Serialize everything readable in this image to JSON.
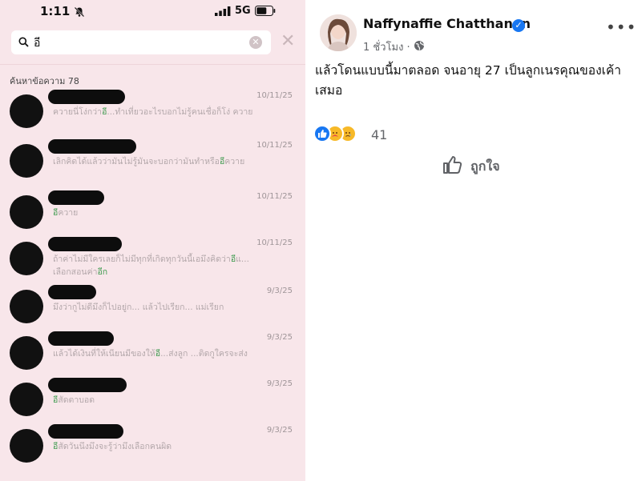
{
  "phone": {
    "status_time": "1:11",
    "network": "5G",
    "search_query": "อี",
    "result_count_label": "ค้นหาข้อความ 78",
    "results": [
      {
        "date": "10/11/25",
        "pre": "ควายนี่โง่กว่า",
        "hl": "อี",
        "post": "...ทำเที่ยวอะไรบอกไม่รู้คนเชื่อก็โง่ ควาย"
      },
      {
        "date": "10/11/25",
        "pre": "เลิกคิดได้แล้วว่ามันไม่รู้มันจะบอกว่ามันทำหรือ",
        "hl": "อี",
        "post": "ควาย"
      },
      {
        "date": "10/11/25",
        "pre": "",
        "hl": "อี",
        "post": "ควาย"
      },
      {
        "date": "10/11/25",
        "pre": "ถ้าค่าไม่มีใครเลยก็ไม่มีทุกที่เกิดทุกวันนี้เอมึงคิดว่า",
        "hl": "อี",
        "post": "แ... เลือกสอนค่า",
        "tail_hl": "อีก"
      },
      {
        "date": "9/3/25",
        "pre": "มึงว่ากูไม่ดีมึงก็ไปอยู่ก... แล้วไปเรียก... แม่เรียก",
        "hl": "",
        "post": ""
      },
      {
        "date": "9/3/25",
        "pre": "แล้วได้เงินที่ให้เนียนมีของให้",
        "hl": "อี",
        "post": "...ส่งลูก ...ติดกูใครจะส่ง"
      },
      {
        "date": "9/3/25",
        "pre": "",
        "hl": "อี",
        "post": "สัดตาบอด"
      },
      {
        "date": "9/3/25",
        "pre": "",
        "hl": "อี",
        "post": "สัดวันนึงมึงจะรู้ว่ามึงเลือกคนผิด"
      }
    ]
  },
  "post": {
    "author": "Naffynaffie Chatthanan",
    "time": "1 ชั่วโมง ·",
    "text": "แล้วโดนแบบนี้มาตลอด จนอายุ 27 เป็นลูกเนรคุณของเค้าเสมอ",
    "reaction_count": "41",
    "like_label": "ถูกใจ",
    "accent": "#1877f2"
  }
}
